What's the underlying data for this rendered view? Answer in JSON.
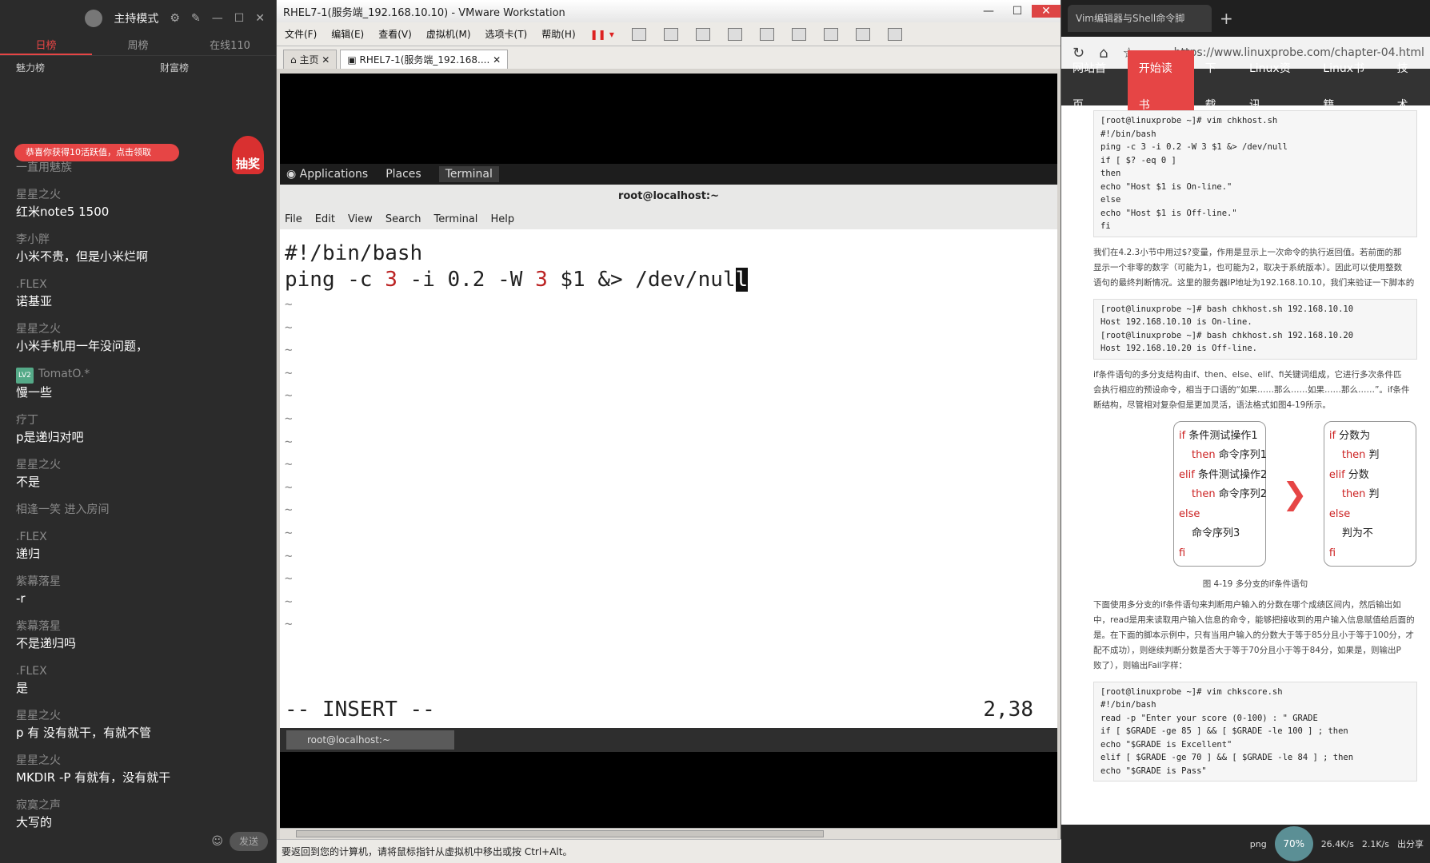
{
  "chat": {
    "mode": "主持模式",
    "tabs": [
      "日榜",
      "周榜",
      "在线110"
    ],
    "ranks": [
      "魅力榜",
      "财富榜"
    ],
    "banner": "恭喜你获得10活跃值，点击领取",
    "chou": "抽奖",
    "messages": [
      {
        "user": "一直用魅族",
        "text": ""
      },
      {
        "user": "星星之火",
        "text": "红米note5 1500"
      },
      {
        "user": "李小胖",
        "text": "小米不贵，但是小米烂啊"
      },
      {
        "user": ".FLEX",
        "text": "诺基亚"
      },
      {
        "user": "星星之火",
        "text": "小米手机用一年没问题，"
      },
      {
        "user": "TomatO.*",
        "text": "慢一些",
        "level": "LV2"
      },
      {
        "user": "疗丁",
        "text": "p是递归对吧"
      },
      {
        "user": "星星之火",
        "text": "不是"
      },
      {
        "user": "相逢一笑 进入房间",
        "text": ""
      },
      {
        "user": ".FLEX",
        "text": "递归"
      },
      {
        "user": "紫幕落星",
        "text": "-r"
      },
      {
        "user": "紫幕落星",
        "text": "不是递归吗"
      },
      {
        "user": ".FLEX",
        "text": "是"
      },
      {
        "user": "星星之火",
        "text": "p 有 没有就干，有就不管"
      },
      {
        "user": "星星之火",
        "text": "MKDIR -P 有就有，没有就干"
      },
      {
        "user": "寂寞之声",
        "text": "大写的"
      }
    ],
    "send": "发送"
  },
  "vm": {
    "title": "RHEL7-1(服务端_192.168.10.10) - VMware Workstation",
    "menu": [
      "文件(F)",
      "编辑(E)",
      "查看(V)",
      "虚拟机(M)",
      "选项卡(T)",
      "帮助(H)"
    ],
    "tabs": [
      "主页",
      "RHEL7-1(服务端_192.168...."
    ],
    "status": "要返回到您的计算机，请将鼠标指针从虚拟机中移出或按 Ctrl+Alt。"
  },
  "gnome": {
    "apps": "Applications",
    "places": "Places",
    "terminal": "Terminal",
    "task": "root@localhost:~"
  },
  "terminal": {
    "title": "root@localhost:~",
    "menu": [
      "File",
      "Edit",
      "View",
      "Search",
      "Terminal",
      "Help"
    ],
    "line1": "#!/bin/bash",
    "line2": {
      "a": "ping -c ",
      "b": "3",
      "c": " -i 0.2 -W ",
      "d": "3",
      "e": " $1 &> /dev/nul",
      "cursor": "l"
    },
    "tildes": [
      "~",
      "~",
      "~",
      "~",
      "~",
      "~",
      "~",
      "~",
      "~",
      "~",
      "~",
      "~",
      "~",
      "~",
      "~"
    ],
    "mode": "-- INSERT --",
    "pos": "2,38"
  },
  "browser": {
    "tab": "Vim编辑器与Shell命令脚",
    "url": "https://www.linuxprobe.com/chapter-04.html",
    "site_nav": [
      "网站首页",
      "开始读书",
      "下载",
      "Linux资讯",
      "Linux书籍",
      "技术"
    ],
    "code1": "[root@linuxprobe ~]# vim chkhost.sh\n#!/bin/bash\nping -c 3 -i 0.2 -W 3 $1 &> /dev/null\nif [ $? -eq 0 ]\nthen\necho \"Host $1 is On-line.\"\nelse\necho \"Host $1 is Off-line.\"\nfi",
    "para1": "我们在4.2.3小节中用过$?变量，作用是显示上一次命令的执行返回值。若前面的那\n显示一个非零的数字（可能为1，也可能为2，取决于系统版本）。因此可以使用整数\n语句的最终判断情况。这里的服务器IP地址为192.168.10.10，我们来验证一下脚本的",
    "code2": "[root@linuxprobe ~]# bash chkhost.sh 192.168.10.10\nHost 192.168.10.10 is On-line.\n[root@linuxprobe ~]# bash chkhost.sh 192.168.10.20\nHost 192.168.10.20 is Off-line.",
    "para2": "if条件语句的多分支结构由if、then、else、elif、fi关键词组成，它进行多次条件匹\n会执行相应的预设命令，相当于口语的“如果……那么……如果……那么……”。if条件\n断结构，尽管相对复杂但是更加灵活，语法格式如图4-19所示。",
    "flow1": [
      {
        "kw": "if",
        "txt": " 条件测试操作1"
      },
      {
        "kw": "then",
        "txt": " 命令序列1",
        "indent": true
      },
      {
        "kw": "elif",
        "txt": " 条件测试操作2"
      },
      {
        "kw": "then",
        "txt": " 命令序列2",
        "indent": true
      },
      {
        "kw": "else",
        "txt": ""
      },
      {
        "kw": "",
        "txt": "命令序列3",
        "indent": true
      },
      {
        "kw": "fi",
        "txt": ""
      }
    ],
    "flow2": [
      {
        "kw": "if",
        "txt": " 分数为"
      },
      {
        "kw": "then",
        "txt": " 判",
        "indent": true
      },
      {
        "kw": "elif",
        "txt": " 分数"
      },
      {
        "kw": "then",
        "txt": " 判",
        "indent": true
      },
      {
        "kw": "else",
        "txt": ""
      },
      {
        "kw": "",
        "txt": "判为不",
        "indent": true
      },
      {
        "kw": "fi",
        "txt": ""
      }
    ],
    "caption": "图 4-19 多分支的if条件语句",
    "para3": "下面使用多分支的if条件语句来判断用户输入的分数在哪个成绩区间内，然后输出如\n中，read是用来读取用户输入信息的命令，能够把接收到的用户输入信息赋值给后面的\n是。在下面的脚本示例中，只有当用户输入的分数大于等于85分且小于等于100分，才\n配不成功），则继续判断分数是否大于等于70分且小于等于84分，如果是，则输出P\n败了），则输出Fail字样：",
    "code3": "[root@linuxprobe ~]# vim chkscore.sh\n#!/bin/bash\nread -p \"Enter your score (0-100) : \" GRADE\nif [ $GRADE -ge 85 ] && [ $GRADE -le 100 ] ; then\necho \"$GRADE is Excellent\"\nelif [ $GRADE -ge 70 ] && [ $GRADE -le 84 ] ; then\necho \"$GRADE is Pass\""
  },
  "tray": {
    "pct": "70%",
    "up": "26.4K/s",
    "down": "2.1K/s",
    "share": "出分享",
    "png": "png"
  }
}
